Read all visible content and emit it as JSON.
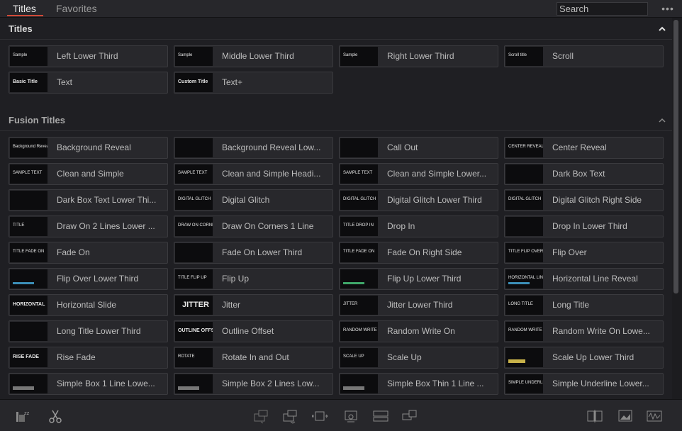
{
  "tabs": [
    {
      "label": "Titles",
      "active": true
    },
    {
      "label": "Favorites",
      "active": false
    }
  ],
  "search": {
    "placeholder": "Search"
  },
  "menu": {
    "label": "•••"
  },
  "sections": [
    {
      "title": "Titles",
      "items": [
        {
          "label": "Left Lower Third",
          "thumb": "Sample"
        },
        {
          "label": "Middle Lower Third",
          "thumb": "Sample"
        },
        {
          "label": "Right Lower Third",
          "thumb": "Sample"
        },
        {
          "label": "Scroll",
          "thumb": "Scroll title"
        },
        {
          "label": "Text",
          "thumb": "Basic Title"
        },
        {
          "label": "Text+",
          "thumb": "Custom Title"
        }
      ]
    },
    {
      "title": "Fusion Titles",
      "items": [
        {
          "label": "Background Reveal",
          "thumb": "Background Reveal"
        },
        {
          "label": "Background Reveal Low...",
          "thumb": ""
        },
        {
          "label": "Call Out",
          "thumb": ""
        },
        {
          "label": "Center Reveal",
          "thumb": "CENTER REVEAL"
        },
        {
          "label": "Clean and Simple",
          "thumb": "SAMPLE TEXT"
        },
        {
          "label": "Clean and Simple Headi...",
          "thumb": "SAMPLE TEXT"
        },
        {
          "label": "Clean and Simple Lower...",
          "thumb": "SAMPLE TEXT"
        },
        {
          "label": "Dark Box Text",
          "thumb": ""
        },
        {
          "label": "Dark Box Text Lower Thi...",
          "thumb": ""
        },
        {
          "label": "Digital Glitch",
          "thumb": "DIGITAL GLITCH"
        },
        {
          "label": "Digital Glitch Lower Third",
          "thumb": "DIGITAL GLITCH"
        },
        {
          "label": "Digital Glitch Right Side",
          "thumb": "DIGITAL GLITCH"
        },
        {
          "label": "Draw On 2 Lines Lower ...",
          "thumb": "TITLE"
        },
        {
          "label": "Draw On Corners 1 Line",
          "thumb": "DRAW ON CORNERS"
        },
        {
          "label": "Drop In",
          "thumb": "TITLE DROP IN"
        },
        {
          "label": "Drop In Lower Third",
          "thumb": ""
        },
        {
          "label": "Fade On",
          "thumb": "TITLE FADE ON"
        },
        {
          "label": "Fade On Lower Third",
          "thumb": ""
        },
        {
          "label": "Fade On Right Side",
          "thumb": "TITLE FADE ON"
        },
        {
          "label": "Flip Over",
          "thumb": "TITLE FLIP OVER"
        },
        {
          "label": "Flip Over Lower Third",
          "thumb": ""
        },
        {
          "label": "Flip Up",
          "thumb": "TITLE FLIP UP"
        },
        {
          "label": "Flip Up Lower Third",
          "thumb": ""
        },
        {
          "label": "Horizontal Line Reveal",
          "thumb": "HORIZONTAL LINE"
        },
        {
          "label": "Horizontal Slide",
          "thumb": "HORIZONTAL"
        },
        {
          "label": "Jitter",
          "thumb": "JITTER"
        },
        {
          "label": "Jitter Lower Third",
          "thumb": "JITTER"
        },
        {
          "label": "Long Title",
          "thumb": "LONG TITLE"
        },
        {
          "label": "Long Title Lower Third",
          "thumb": ""
        },
        {
          "label": "Outline Offset",
          "thumb": "OUTLINE OFFSET"
        },
        {
          "label": "Random Write On",
          "thumb": "RANDOM WRITE ON"
        },
        {
          "label": "Random Write On Lowe...",
          "thumb": "RANDOM WRITE ON"
        },
        {
          "label": "Rise Fade",
          "thumb": "RISE FADE"
        },
        {
          "label": "Rotate In and Out",
          "thumb": "ROTATE"
        },
        {
          "label": "Scale Up",
          "thumb": "SCALE UP"
        },
        {
          "label": "Scale Up Lower Third",
          "thumb": ""
        },
        {
          "label": "Simple Box 1 Line Lowe...",
          "thumb": ""
        },
        {
          "label": "Simple Box 2 Lines Low...",
          "thumb": ""
        },
        {
          "label": "Simple Box Thin 1 Line ...",
          "thumb": ""
        },
        {
          "label": "Simple Underline Lower...",
          "thumb": "SIMPLE UNDERLINE"
        }
      ]
    }
  ],
  "bottom_icons": [
    "sleep-zz-icon",
    "scissors-icon",
    "insert-clip-icon",
    "overwrite-clip-icon",
    "replace-clip-icon",
    "fit-to-fill-icon",
    "place-on-top-icon",
    "append-at-end-icon",
    "source-overwrite-icon",
    "viewer-icon",
    "waveform-icon"
  ],
  "colors": {
    "accent": "#d24a38",
    "background": "#1f1f23",
    "tile": "#28282c"
  }
}
